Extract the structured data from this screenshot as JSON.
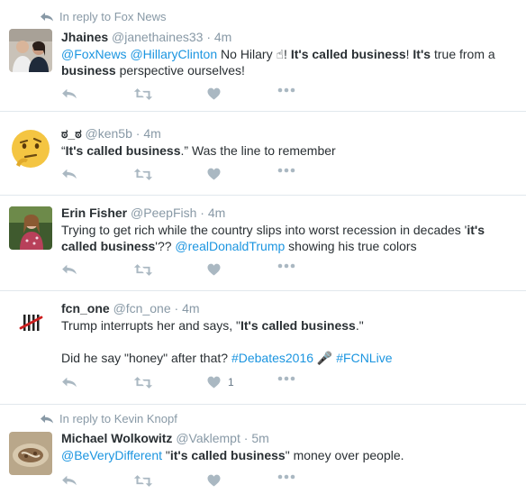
{
  "tweets": [
    {
      "reply_context": "In reply to Fox News",
      "name": "Jhaines",
      "handle": "@janethaines33",
      "time": "4m",
      "body": [
        {
          "t": "link",
          "v": "@FoxNews"
        },
        {
          "t": "text",
          "v": " "
        },
        {
          "t": "link",
          "v": "@HillaryClinton"
        },
        {
          "t": "text",
          "v": " No Hilary "
        },
        {
          "t": "emoji",
          "v": "☝"
        },
        {
          "t": "text",
          "v": "! "
        },
        {
          "t": "bold",
          "v": "It's called business"
        },
        {
          "t": "text",
          "v": "! "
        },
        {
          "t": "bold",
          "v": "It's"
        },
        {
          "t": "text",
          "v": " true from a "
        },
        {
          "t": "bold",
          "v": "business"
        },
        {
          "t": "text",
          "v": " perspective ourselves!"
        }
      ],
      "like_count": ""
    },
    {
      "reply_context": "",
      "name": "ಠ_ಠ",
      "handle": "@ken5b",
      "time": "4m",
      "body": [
        {
          "t": "text",
          "v": "“"
        },
        {
          "t": "bold",
          "v": "It's called business"
        },
        {
          "t": "text",
          "v": ".” Was the line to remember"
        }
      ],
      "like_count": ""
    },
    {
      "reply_context": "",
      "name": "Erin Fisher",
      "handle": "@PeepFish",
      "time": "4m",
      "body": [
        {
          "t": "text",
          "v": "Trying to get rich while the country slips into worst recession in decades '"
        },
        {
          "t": "bold",
          "v": "it's called business"
        },
        {
          "t": "text",
          "v": "'?? "
        },
        {
          "t": "link",
          "v": "@realDonaldTrump"
        },
        {
          "t": "text",
          "v": " showing his true colors"
        }
      ],
      "like_count": ""
    },
    {
      "reply_context": "",
      "name": "fcn_one",
      "handle": "@fcn_one",
      "time": "4m",
      "body": [
        {
          "t": "text",
          "v": "Trump interrupts her and says, \""
        },
        {
          "t": "bold",
          "v": "It's called business"
        },
        {
          "t": "text",
          "v": ".\""
        },
        {
          "t": "br",
          "v": ""
        },
        {
          "t": "br",
          "v": ""
        },
        {
          "t": "text",
          "v": "Did he say \"honey\" after that?  "
        },
        {
          "t": "link",
          "v": "#Debates2016"
        },
        {
          "t": "text",
          "v": " "
        },
        {
          "t": "emoji",
          "v": "🎤"
        },
        {
          "t": "text",
          "v": "  "
        },
        {
          "t": "link",
          "v": "#FCNLive"
        }
      ],
      "like_count": "1"
    },
    {
      "reply_context": "In reply to Kevin Knopf",
      "name": "Michael Wolkowitz",
      "handle": "@Vaklempt",
      "time": "5m",
      "body": [
        {
          "t": "link",
          "v": "@BeVeryDifferent"
        },
        {
          "t": "text",
          "v": " \""
        },
        {
          "t": "bold",
          "v": "it's called business"
        },
        {
          "t": "text",
          "v": "\" money over people."
        }
      ],
      "like_count": ""
    }
  ],
  "colors": {
    "link": "#1b95e0",
    "meta": "#8899a6",
    "action_icon": "#aab8c2",
    "text": "#292f33"
  },
  "icons": [
    "reply-icon",
    "retweet-icon",
    "like-icon",
    "more-icon",
    "reply-context-arrow-icon"
  ]
}
